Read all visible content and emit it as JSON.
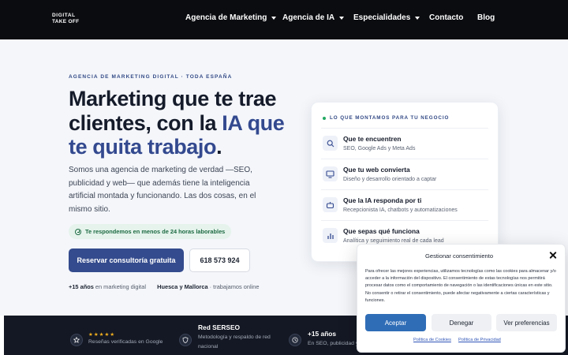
{
  "nav": {
    "logo_line1": "DIGITAL",
    "logo_line2": "TAKE OFF",
    "items": [
      {
        "label": "Agencia de Marketing",
        "has_dropdown": true
      },
      {
        "label": "Agencia de IA",
        "has_dropdown": true
      },
      {
        "label": "Especialidades",
        "has_dropdown": true
      },
      {
        "label": "Contacto",
        "has_dropdown": false
      },
      {
        "label": "Blog",
        "has_dropdown": false
      }
    ]
  },
  "hero": {
    "eyebrow": "AGENCIA DE MARKETING DIGITAL · TODA ESPAÑA",
    "headline_line1": "Marketing que te trae",
    "headline_line2_plain": "clientes, con la ",
    "headline_line2_highlight": "IA que",
    "headline_line3_highlight": "te quita trabajo",
    "headline_line3_end": ".",
    "description": "Somos una agencia de marketing de verdad —SEO, publicidad y web— que además tiene la inteligencia artificial montada y funcionando. Las dos cosas, en el mismo sitio.",
    "response_badge": "Te respondemos en menos de 24 horas laborables",
    "cta_primary": "Reservar consultoría gratuita",
    "cta_phone": "618 573 924",
    "stat1_bold": "+15 años",
    "stat1_text": " en marketing digital",
    "stat2_bold": "Huesca y Mallorca",
    "stat2_text": " · trabajamos online"
  },
  "card": {
    "title": "LO QUE MONTAMOS PARA TU NEGOCIO",
    "items": [
      {
        "icon": "search-icon",
        "title": "Que te encuentren",
        "subtitle": "SEO, Google Ads y Meta Ads"
      },
      {
        "icon": "monitor-icon",
        "title": "Que tu web convierta",
        "subtitle": "Diseño y desarrollo orientado a captar"
      },
      {
        "icon": "robot-icon",
        "title": "Que la IA responda por ti",
        "subtitle": "Recepcionista IA, chatbots y automatizaciones"
      },
      {
        "icon": "bar-chart-icon",
        "title": "Que sepas qué funciona",
        "subtitle": "Analítica y seguimiento real de cada lead"
      }
    ]
  },
  "trust": {
    "reviews_stars": "★★★★★",
    "reviews_text": "Reseñas verificadas en Google",
    "serseo_title": "Red SERSEO",
    "serseo_text": "Metodología y respaldo de red nacional",
    "years_title": "+15 años",
    "years_text": "En SEO, publicidad y"
  },
  "consent": {
    "title": "Gestionar consentimiento",
    "body": "Para ofrecer las mejores experiencias, utilizamos tecnologías como las cookies para almacenar y/o acceder a la información del dispositivo. El consentimiento de estas tecnologías nos permitirá procesar datos como el comportamiento de navegación o las identificaciones únicas en este sitio. No consentir o retirar el consentimiento, puede afectar negativamente a ciertas características y funciones.",
    "accept": "Aceptar",
    "deny": "Denegar",
    "preferences": "Ver preferencias",
    "cookie_policy": "Política de Cookies",
    "privacy_policy": "Política de Privacidad"
  },
  "colors": {
    "nav_bg": "#0b0c10",
    "accent": "#344b8d",
    "highlight_text": "#33498f",
    "consent_accept": "#2f6db7",
    "success": "#22a862"
  }
}
